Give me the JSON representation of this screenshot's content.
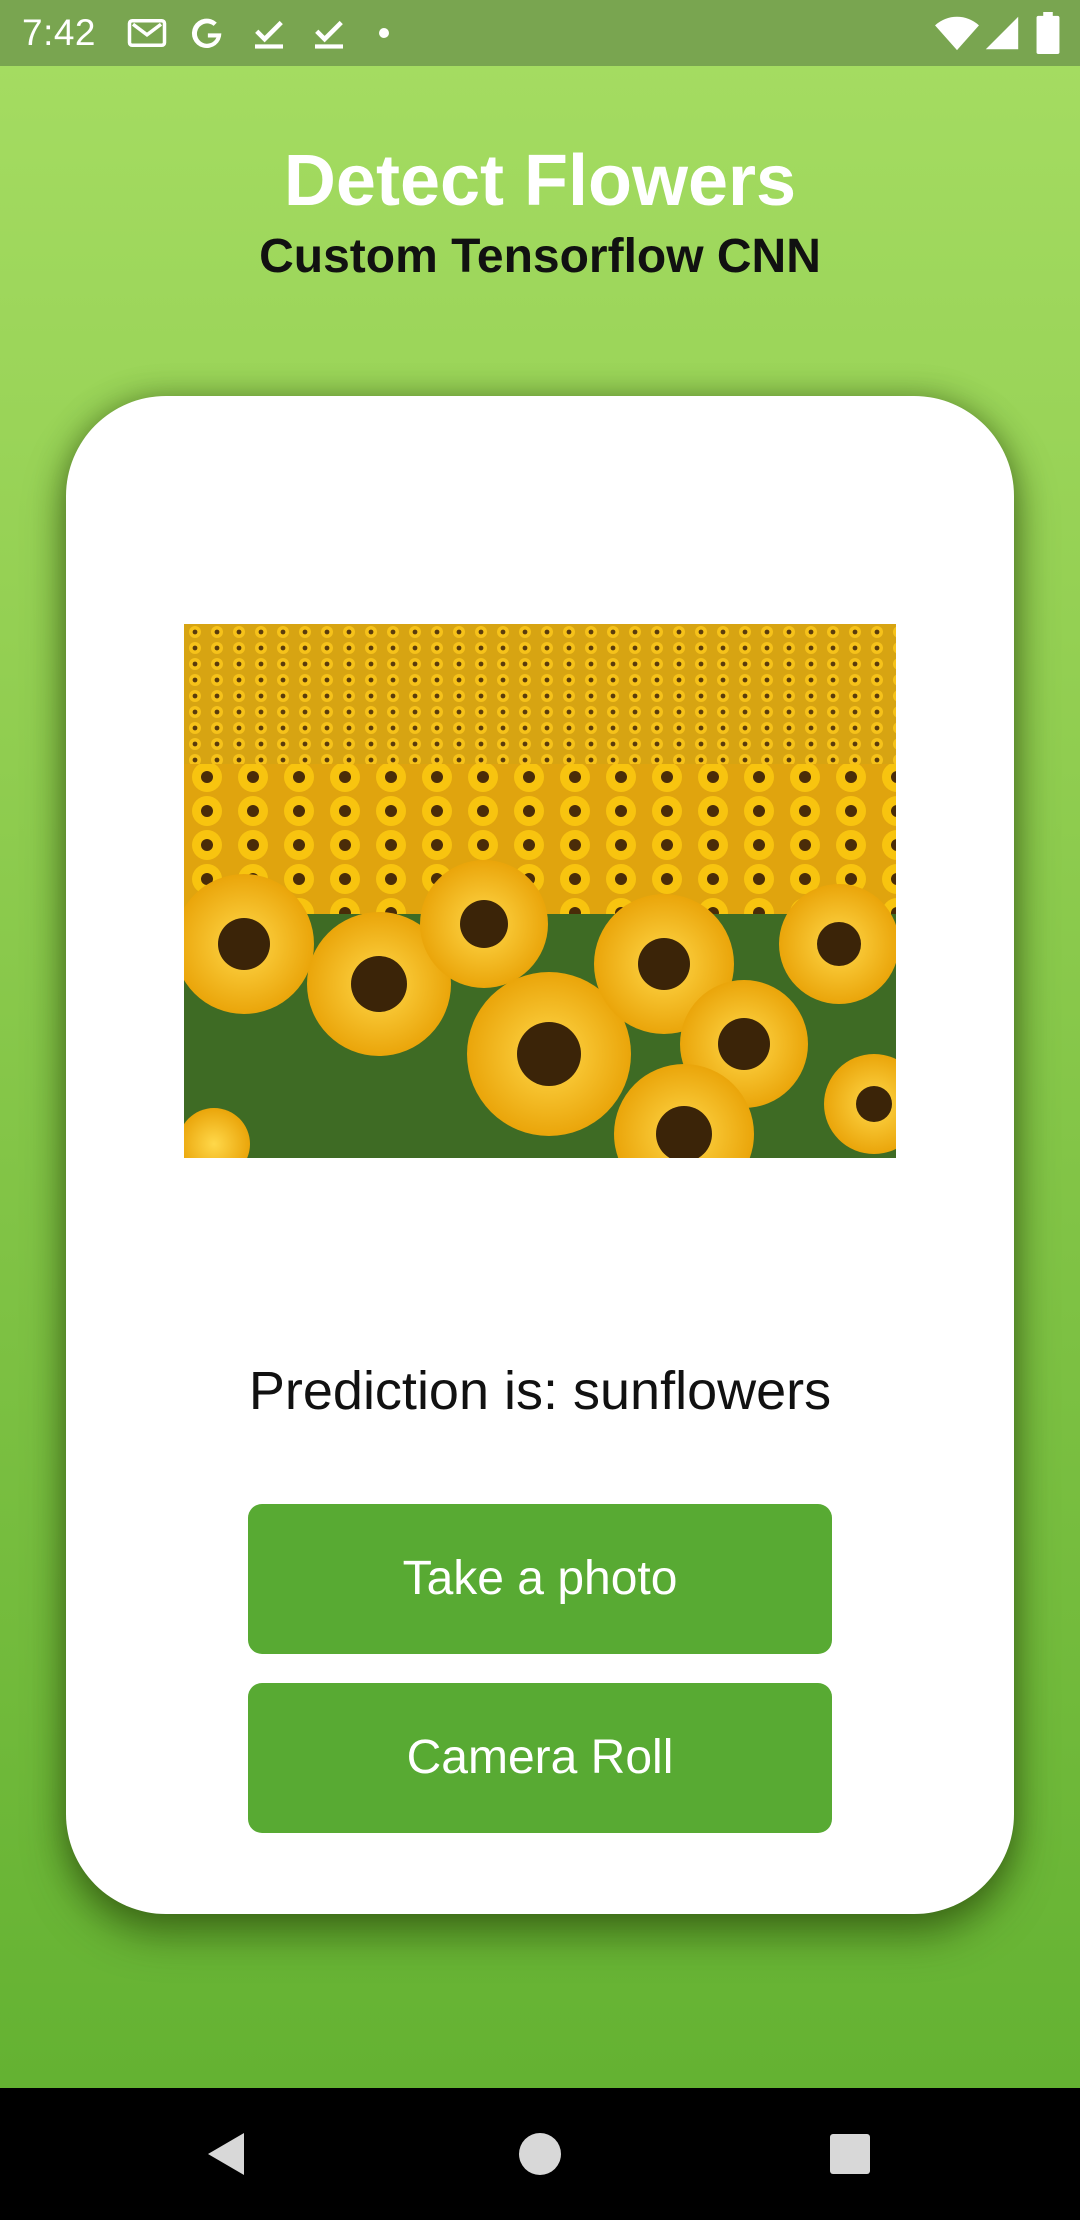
{
  "status_bar": {
    "time": "7:42",
    "left_icons": [
      "gmail-icon",
      "google-icon",
      "download-done-icon",
      "download-done-icon",
      "dot-icon"
    ],
    "right_icons": [
      "wifi-icon",
      "signal-icon",
      "battery-icon"
    ]
  },
  "header": {
    "title": "Detect Flowers",
    "subtitle": "Custom Tensorflow CNN"
  },
  "card": {
    "image_subject": "sunflower field photo",
    "prediction": "Prediction is: sunflowers",
    "take_photo_label": "Take a photo",
    "camera_roll_label": "Camera Roll"
  },
  "nav_bar": {
    "buttons": [
      "back-icon",
      "home-icon",
      "recents-icon"
    ]
  },
  "colors": {
    "gradient_top": "#a6dd63",
    "gradient_bottom": "#64b232",
    "status_bar": "#79a550",
    "button": "#58aa33",
    "title_text": "#ffffff",
    "subtitle_text": "#111111"
  }
}
